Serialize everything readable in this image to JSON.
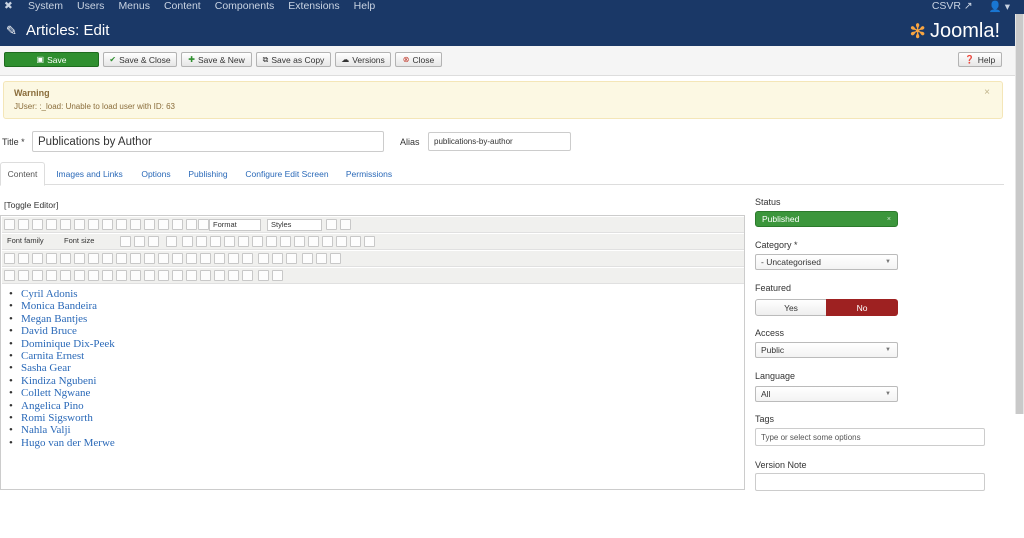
{
  "topnav": {
    "logo": "✖",
    "items": [
      "System",
      "Users",
      "Menus",
      "Content",
      "Components",
      "Extensions",
      "Help"
    ],
    "site": "CSVR ↗",
    "user": "👤 ▾"
  },
  "header": {
    "title": "Articles: Edit",
    "brand": "Joomla!"
  },
  "toolbar": {
    "save": "Save",
    "save_close": "Save & Close",
    "save_new": "Save & New",
    "save_copy": "Save as Copy",
    "versions": "Versions",
    "close": "Close",
    "help": "Help"
  },
  "alert": {
    "heading": "Warning",
    "message": "JUser: :_load: Unable to load user with ID: 63",
    "close": "×"
  },
  "form": {
    "title_label": "Title *",
    "title_value": "Publications by Author",
    "alias_label": "Alias",
    "alias_value": "publications-by-author"
  },
  "tabs": [
    "Content",
    "Images and Links",
    "Options",
    "Publishing",
    "Configure Edit Screen",
    "Permissions"
  ],
  "editor": {
    "toggle": "[Toggle Editor]",
    "format": "Format",
    "styles": "Styles",
    "font_family": "Font family",
    "font_size": "Font size",
    "items": [
      "Cyril Adonis",
      "Monica Bandeira",
      "Megan Bantjes",
      "David Bruce",
      "Dominique Dix-Peek",
      "Carnita Ernest",
      "Sasha Gear",
      "Kindiza Ngubeni",
      "Collett Ngwane",
      "Angelica Pino",
      "Romi Sigsworth",
      "Nahla Valji",
      "Hugo van der Merwe"
    ]
  },
  "sidebar": {
    "status_label": "Status",
    "status_value": "Published",
    "category_label": "Category *",
    "category_value": "- Uncategorised",
    "featured_label": "Featured",
    "yes": "Yes",
    "no": "No",
    "access_label": "Access",
    "access_value": "Public",
    "language_label": "Language",
    "language_value": "All",
    "tags_label": "Tags",
    "tags_placeholder": "Type or select some options",
    "version_label": "Version Note"
  },
  "colors": {
    "navy": "#1a3867",
    "green": "#2f8f2f",
    "red": "#9e2121"
  }
}
